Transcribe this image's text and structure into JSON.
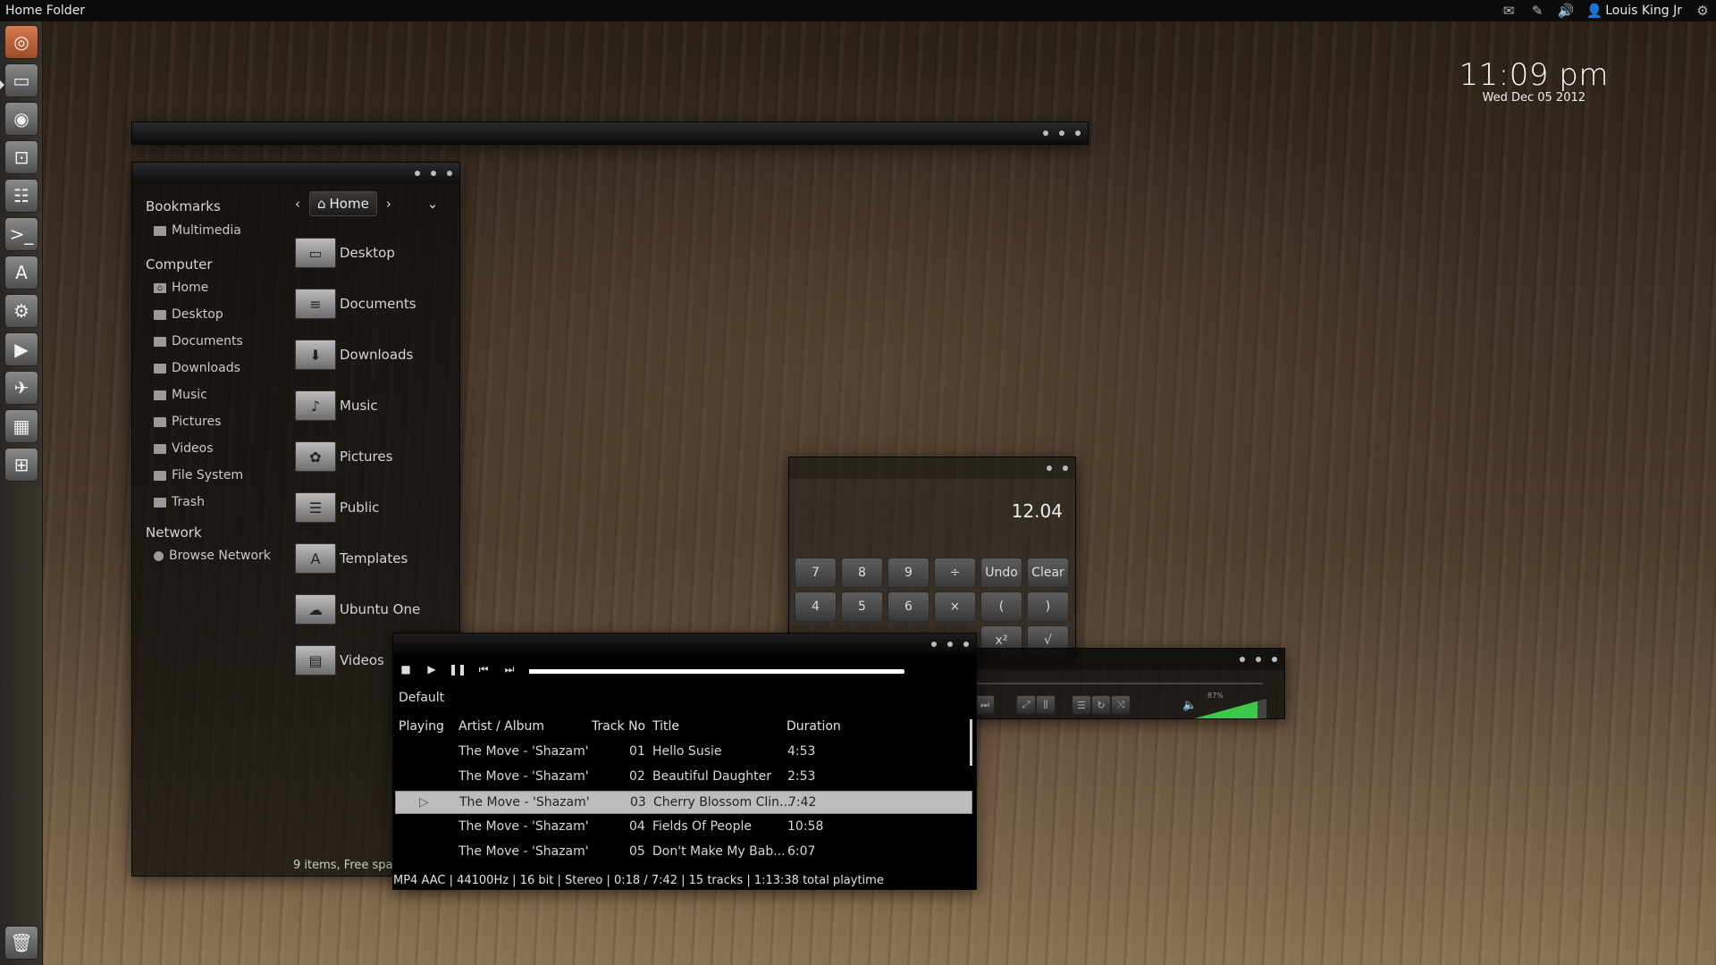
{
  "panel": {
    "title": "Home Folder",
    "user": "Louis King Jr",
    "icons": [
      "mail-icon",
      "pen-icon",
      "volume-icon",
      "user-icon",
      "gear-icon"
    ]
  },
  "clock": {
    "time": "11:09 pm",
    "date": "Wed Dec 05 2012"
  },
  "file_manager": {
    "sidebar": {
      "bookmarks_label": "Bookmarks",
      "bookmarks": [
        "Multimedia"
      ],
      "computer_label": "Computer",
      "computer": [
        "Home",
        "Desktop",
        "Documents",
        "Downloads",
        "Music",
        "Pictures",
        "Videos",
        "File System",
        "Trash"
      ],
      "network_label": "Network",
      "network": [
        "Browse Network"
      ]
    },
    "path": "Home",
    "folders": [
      "Desktop",
      "Documents",
      "Downloads",
      "Music",
      "Pictures",
      "Public",
      "Templates",
      "Ubuntu One",
      "Videos"
    ],
    "status": "9 items, Free spac"
  },
  "calculator": {
    "display": "12.04",
    "row1": [
      "7",
      "8",
      "9",
      "÷",
      "Undo",
      "Clear"
    ],
    "row2": [
      "4",
      "5",
      "6",
      "×",
      "(",
      ")"
    ],
    "row3": [
      "x²",
      "√"
    ]
  },
  "mini_player": {
    "volume": "87%",
    "volume_level": 0.87
  },
  "player": {
    "playlist": "Default",
    "headers": {
      "playing": "Playing",
      "artist": "Artist / Album",
      "track": "Track No",
      "title": "Title",
      "duration": "Duration"
    },
    "tracks": [
      {
        "artist": "The Move - 'Shazam'",
        "no": "01",
        "title": "Hello Susie",
        "duration": "4:53"
      },
      {
        "artist": "The Move - 'Shazam'",
        "no": "02",
        "title": "Beautiful Daughter",
        "duration": "2:53"
      },
      {
        "artist": "The Move - 'Shazam'",
        "no": "03",
        "title": "Cherry Blossom Clin...",
        "duration": "7:42",
        "playing": true
      },
      {
        "artist": "The Move - 'Shazam'",
        "no": "04",
        "title": "Fields Of People",
        "duration": "10:58"
      },
      {
        "artist": "The Move - 'Shazam'",
        "no": "05",
        "title": "Don't Make My Bab...",
        "duration": "6:07"
      }
    ],
    "progress": 0.04,
    "status": "MP4 AAC | 44100Hz | 16 bit | Stereo | 0:18 / 7:42 | 15 tracks | 1:13:38 total playtime"
  },
  "launcher": {
    "items": [
      "ubuntu-icon",
      "files-icon",
      "firefox-icon",
      "screenshot-icon",
      "mixer-icon",
      "terminal-icon",
      "software-center-icon",
      "settings-icon",
      "media-player-icon",
      "bird-icon",
      "calculator-icon",
      "workspace-icon",
      "trash-icon"
    ]
  }
}
